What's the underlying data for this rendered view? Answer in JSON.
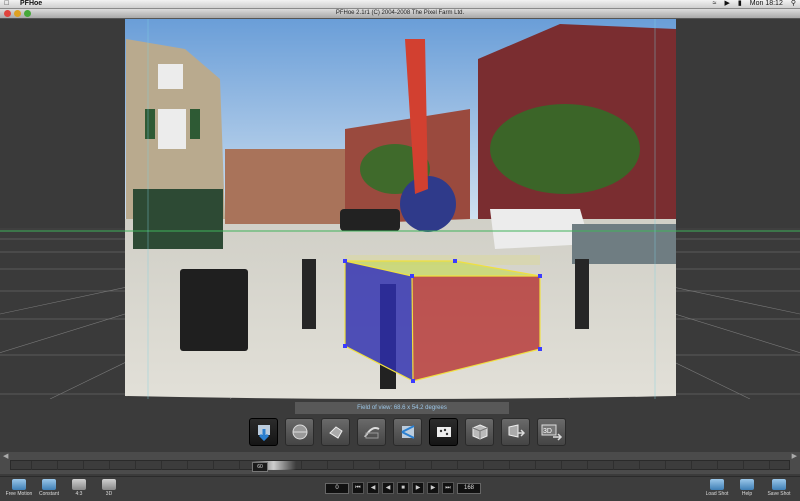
{
  "menubar": {
    "apple": "",
    "app_name": "PFHoe",
    "time": "Mon 18:12"
  },
  "window": {
    "title": "PFHoe 2.1r1 (C) 2004-2008 The Pixel Farm Ltd."
  },
  "viewport": {
    "field_of_view": "Field of view: 68.6 x 54.2 degrees"
  },
  "toolbar": {
    "tools": [
      {
        "name": "lens-tool"
      },
      {
        "name": "sphere-tool"
      },
      {
        "name": "rotate-tool"
      },
      {
        "name": "curve-tool"
      },
      {
        "name": "vanishing-tool"
      },
      {
        "name": "points-tool"
      },
      {
        "name": "cube-tool"
      },
      {
        "name": "grid-export-tool"
      },
      {
        "name": "3d-export-tool",
        "label": "3D"
      }
    ]
  },
  "timeline": {
    "current_frame": "60"
  },
  "bottom": {
    "free_motion": "Free Motion",
    "constant": "Constant",
    "aspect": "4:3",
    "view3d": "3D",
    "start_frame": "0",
    "end_frame": "168",
    "load_shot": "Load Shot",
    "help": "Help",
    "save_shot": "Save Shot"
  },
  "colors": {
    "accent": "#4a90d9",
    "grid": "#7a7a7a"
  }
}
